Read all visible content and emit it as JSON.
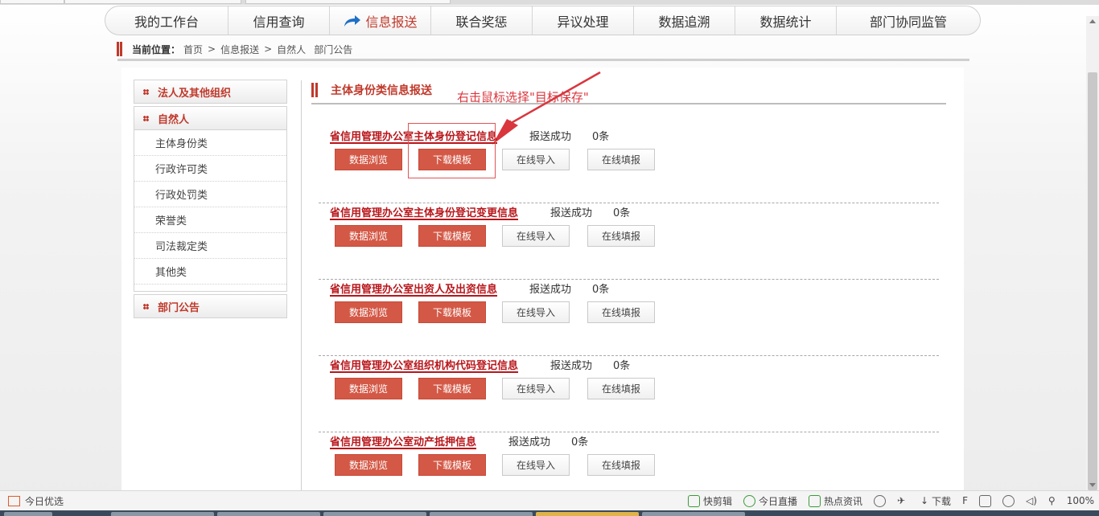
{
  "nav": {
    "items": [
      "我的工作台",
      "信用查询",
      "信息报送",
      "联合奖惩",
      "异议处理",
      "数据追溯",
      "数据统计",
      "部门协同监管"
    ],
    "active_index": 2
  },
  "breadcrumb": {
    "label": "当前位置：",
    "items": [
      "首页",
      "信息报送",
      "自然人",
      "部门公告"
    ]
  },
  "sidebar": {
    "group1": "法人及其他组织",
    "group2": "自然人",
    "group2_items": [
      "主体身份类",
      "行政许可类",
      "行政处罚类",
      "荣誉类",
      "司法裁定类",
      "其他类"
    ],
    "group3": "部门公告"
  },
  "content": {
    "section_title": "主体身份类信息报送",
    "annotation": "右击鼠标选择\"目标保存\"",
    "records": [
      {
        "title": "省信用管理办公室主体身份登记信息",
        "status": "报送成功",
        "count": "0条"
      },
      {
        "title": "省信用管理办公室主体身份登记变更信息",
        "status": "报送成功",
        "count": "0条"
      },
      {
        "title": "省信用管理办公室出资人及出资信息",
        "status": "报送成功",
        "count": "0条"
      },
      {
        "title": "省信用管理办公室组织机构代码登记信息",
        "status": "报送成功",
        "count": "0条"
      },
      {
        "title": "省信用管理办公室动产抵押信息",
        "status": "报送成功",
        "count": "0条"
      }
    ],
    "buttons": {
      "browse": "数据浏览",
      "download": "下载模板",
      "import": "在线导入",
      "fill": "在线填报"
    }
  },
  "statusbar": {
    "left": "今日优选",
    "items": [
      "快剪辑",
      "今日直播",
      "热点资讯"
    ],
    "download": "下载",
    "zoom": "100%"
  },
  "colors": {
    "accent": "#c0392b",
    "button_red": "#d35846",
    "annotation_red": "#d9363e"
  }
}
